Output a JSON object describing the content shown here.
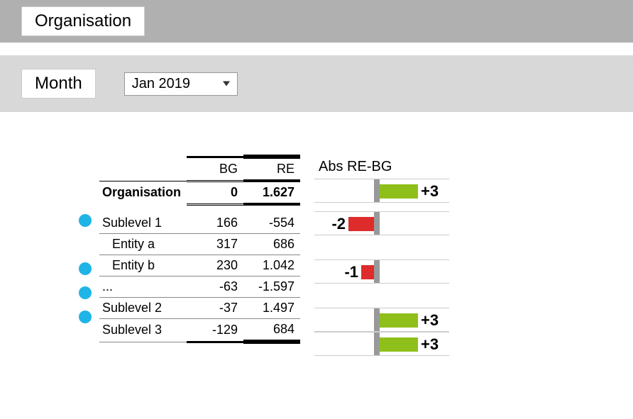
{
  "header": {
    "org_label": "Organisation",
    "month_label": "Month",
    "month_value": "Jan 2019"
  },
  "table": {
    "col_bg": "BG",
    "col_re": "RE",
    "rows": [
      {
        "label": "Organisation",
        "bg": "0",
        "re": "1.627",
        "kind": "org"
      },
      {
        "label": "Sublevel 1",
        "bg": "166",
        "re": "-554",
        "bullet": true
      },
      {
        "label": "Entity a",
        "bg": "317",
        "re": "686",
        "indent": true
      },
      {
        "label": "Entity b",
        "bg": "230",
        "re": "1.042",
        "bullet": true,
        "indent": true
      },
      {
        "label": "...",
        "bg": "-63",
        "re": "-1.597",
        "bullet": true
      },
      {
        "label": "Sublevel 2",
        "bg": "-37",
        "re": "1.497",
        "bullet": true
      },
      {
        "label": "Sublevel 3",
        "bg": "-129",
        "re": "684"
      }
    ]
  },
  "chart_data": {
    "type": "bar",
    "title": "Abs RE-BG",
    "categories": [
      "Organisation",
      "Sublevel 1",
      "Entity a",
      "Entity b",
      "...",
      "Sublevel 2",
      "Sublevel 3"
    ],
    "values": [
      3,
      -2,
      null,
      -1,
      null,
      3,
      3
    ],
    "xlim": [
      -3,
      4
    ]
  },
  "colors": {
    "pos": "#8fbf1a",
    "neg": "#de2c2c",
    "bullet": "#1eb4e6"
  }
}
